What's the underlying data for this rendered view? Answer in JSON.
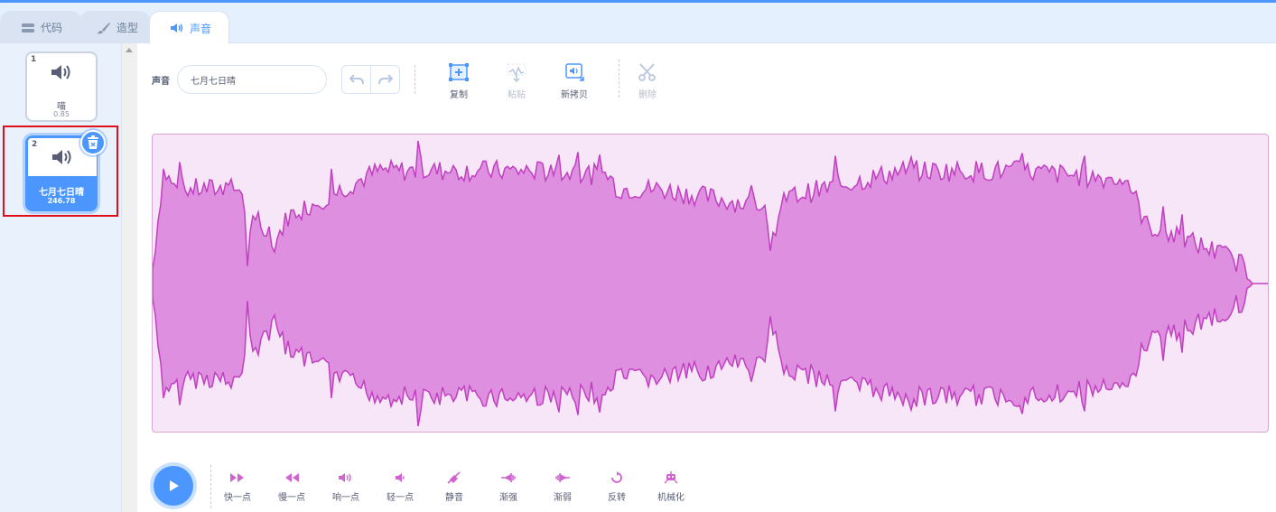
{
  "tabs": [
    {
      "label": "代码",
      "icon": "code-icon"
    },
    {
      "label": "造型",
      "icon": "brush-icon"
    },
    {
      "label": "声音",
      "icon": "speaker-icon"
    }
  ],
  "sound_list": [
    {
      "number": "1",
      "name": "喵",
      "duration": "0.85"
    },
    {
      "number": "2",
      "name": "七月七日晴",
      "duration": "246.78"
    }
  ],
  "editor": {
    "sound_label": "声音",
    "sound_name": "七月七日晴"
  },
  "toolbar": {
    "copy": "复制",
    "paste": "粘贴",
    "copy_to_new": "新拷贝",
    "delete": "删除"
  },
  "effects": [
    {
      "label": "快一点",
      "icon": "faster-icon"
    },
    {
      "label": "慢一点",
      "icon": "slower-icon"
    },
    {
      "label": "响一点",
      "icon": "louder-icon"
    },
    {
      "label": "轻一点",
      "icon": "softer-icon"
    },
    {
      "label": "静音",
      "icon": "mute-icon"
    },
    {
      "label": "渐强",
      "icon": "fade-in-icon"
    },
    {
      "label": "渐弱",
      "icon": "fade-out-icon"
    },
    {
      "label": "反转",
      "icon": "reverse-icon"
    },
    {
      "label": "机械化",
      "icon": "robot-icon"
    }
  ],
  "colors": {
    "accent": "#4c97ff",
    "sound_purple": "#cf63cf",
    "wave_fill": "#df8fdf",
    "wave_stroke": "#c040c0",
    "wave_bg": "#f7e6f7",
    "selection_outline": "#e0101a"
  }
}
